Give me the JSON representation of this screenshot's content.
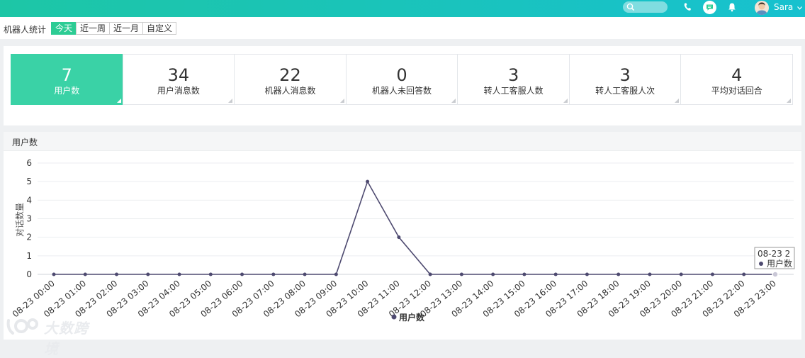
{
  "topbar": {
    "username": "Sara",
    "icons": [
      "search-icon",
      "phone-icon",
      "chat-icon",
      "bell-icon",
      "avatar",
      "caret-down-icon"
    ],
    "gradient": [
      "#1dc6a6",
      "#17c1cf"
    ]
  },
  "filter": {
    "title": "机器人统计",
    "ranges": [
      "今天",
      "近一周",
      "近一月",
      "自定义"
    ],
    "active": "今天"
  },
  "stats": [
    {
      "value": "7",
      "label": "用户数",
      "active": true
    },
    {
      "value": "34",
      "label": "用户消息数",
      "active": false
    },
    {
      "value": "22",
      "label": "机器人消息数",
      "active": false
    },
    {
      "value": "0",
      "label": "机器人未回答数",
      "active": false
    },
    {
      "value": "3",
      "label": "转人工客服人数",
      "active": false
    },
    {
      "value": "3",
      "label": "转人工客服人次",
      "active": false
    },
    {
      "value": "4",
      "label": "平均对话回合",
      "active": false
    }
  ],
  "chart_panel": {
    "title": "用户数"
  },
  "chart_data": {
    "type": "line",
    "ylabel": "对话数量",
    "ylim": [
      0,
      6
    ],
    "yticks": [
      0,
      1,
      2,
      3,
      4,
      5,
      6
    ],
    "categories": [
      "08-23 00:00",
      "08-23 01:00",
      "08-23 02:00",
      "08-23 03:00",
      "08-23 04:00",
      "08-23 05:00",
      "08-23 06:00",
      "08-23 07:00",
      "08-23 08:00",
      "08-23 09:00",
      "08-23 10:00",
      "08-23 11:00",
      "08-23 12:00",
      "08-23 13:00",
      "08-23 14:00",
      "08-23 15:00",
      "08-23 16:00",
      "08-23 17:00",
      "08-23 18:00",
      "08-23 19:00",
      "08-23 20:00",
      "08-23 21:00",
      "08-23 22:00",
      "08-23 23:00"
    ],
    "series": [
      {
        "name": "用户数",
        "color": "#4e4a70",
        "values": [
          0,
          0,
          0,
          0,
          0,
          0,
          0,
          0,
          0,
          0,
          5,
          2,
          0,
          0,
          0,
          0,
          0,
          0,
          0,
          0,
          0,
          0,
          0,
          0
        ]
      }
    ],
    "legend": "bottom",
    "grid": true,
    "tooltip": {
      "title": "08-23 2",
      "label": "用户数"
    }
  },
  "watermark": {
    "text": "大数跨境"
  }
}
